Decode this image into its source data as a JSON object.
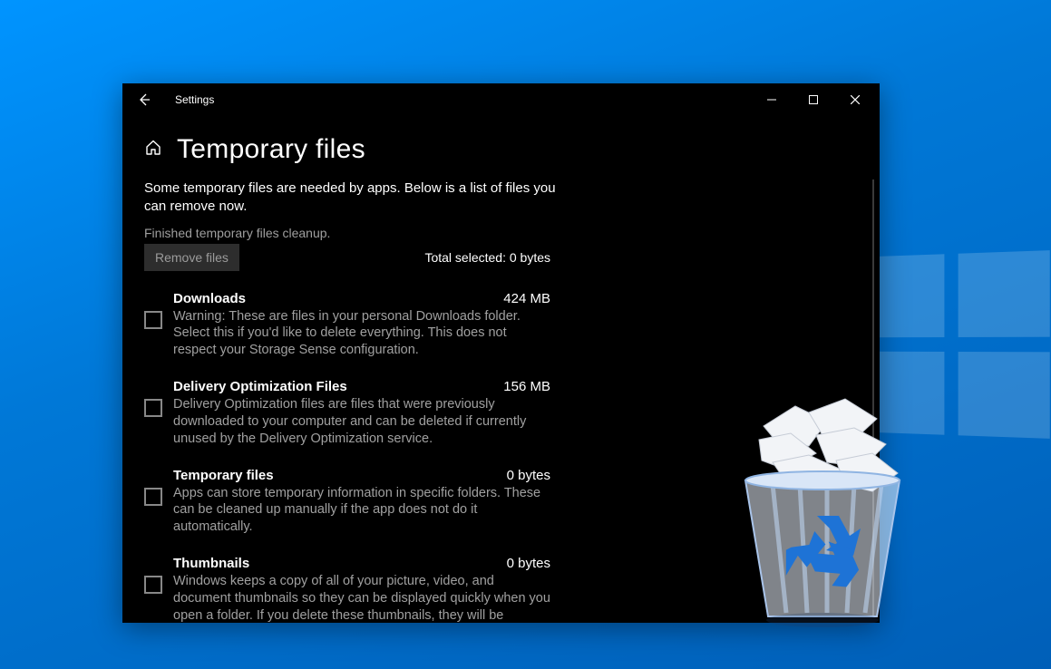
{
  "titlebar": {
    "app_name": "Settings"
  },
  "page": {
    "title": "Temporary files",
    "intro": "Some temporary files are needed by apps. Below is a list of files you can remove now.",
    "status": "Finished temporary files cleanup.",
    "remove_label": "Remove files",
    "total_label": "Total selected: 0 bytes"
  },
  "items": [
    {
      "title": "Downloads",
      "size": "424 MB",
      "desc": "Warning: These are files in your personal Downloads folder. Select this if you'd like to delete everything. This does not respect your Storage Sense configuration."
    },
    {
      "title": "Delivery Optimization Files",
      "size": "156 MB",
      "desc": "Delivery Optimization files are files that were previously downloaded to your computer and can be deleted if currently unused by the Delivery Optimization service."
    },
    {
      "title": "Temporary files",
      "size": "0 bytes",
      "desc": "Apps can store temporary information in specific folders. These can be cleaned up manually if the app does not do it automatically."
    },
    {
      "title": "Thumbnails",
      "size": "0 bytes",
      "desc": "Windows keeps a copy of all of your picture, video, and document thumbnails so they can be displayed quickly when you open a folder. If you delete these thumbnails, they will be"
    }
  ]
}
